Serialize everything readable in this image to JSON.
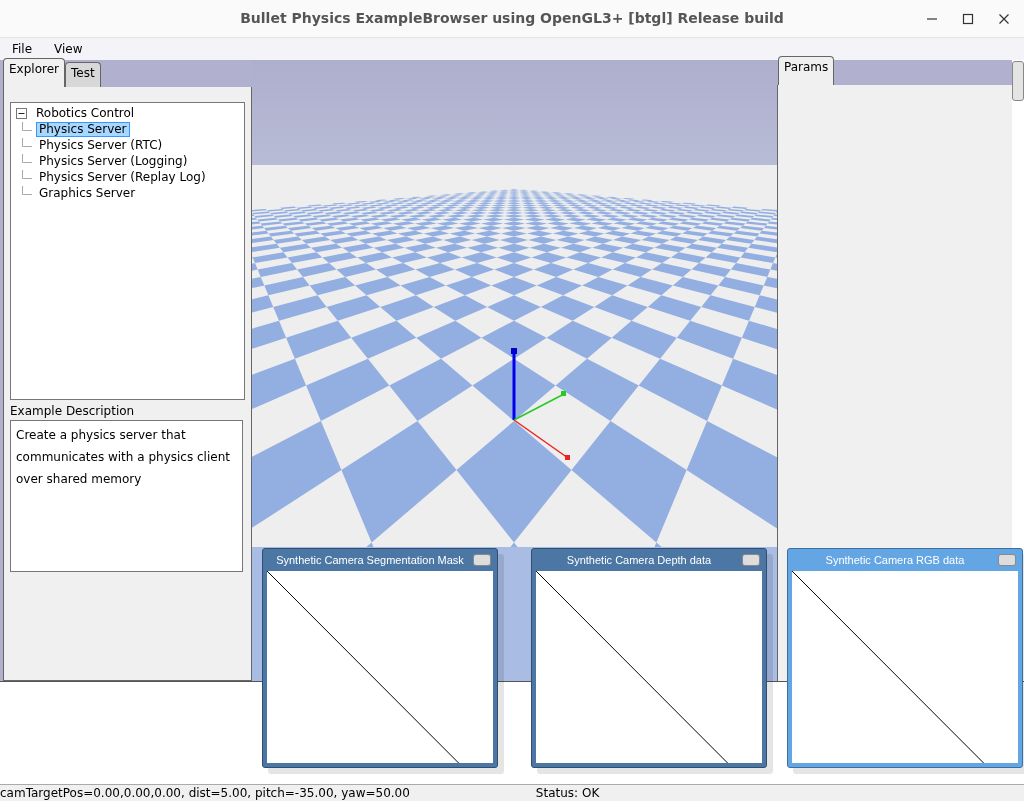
{
  "window": {
    "title": "Bullet Physics ExampleBrowser using OpenGL3+ [btgl] Release build"
  },
  "menu": [
    "File",
    "View"
  ],
  "left_tabs": [
    {
      "label": "Explorer",
      "selected": true
    },
    {
      "label": "Test",
      "selected": false
    }
  ],
  "tree": [
    {
      "label": "Robotics Control",
      "expanded": true,
      "selected": false,
      "children": [
        {
          "label": "Physics Server",
          "selected": true
        },
        {
          "label": "Physics Server (RTC)",
          "selected": false
        },
        {
          "label": "Physics Server (Logging)",
          "selected": false
        },
        {
          "label": "Physics Server (Replay Log)",
          "selected": false
        },
        {
          "label": "Graphics Server",
          "selected": false
        }
      ]
    }
  ],
  "description": {
    "heading": "Example Description",
    "lines": [
      "Create a physics server that",
      "communicates with a physics client",
      "over shared memory"
    ]
  },
  "right_tabs": [
    {
      "label": "Params",
      "selected": true
    }
  ],
  "camera_windows": [
    {
      "title": "Synthetic Camera Segmentation Mask",
      "active": false
    },
    {
      "title": "Synthetic Camera Depth data",
      "active": false
    },
    {
      "title": "Synthetic Camera RGB data",
      "active": true
    }
  ],
  "status_bar": {
    "camera": "camTargetPos=0.00,0.00,0.00, dist=5.00, pitch=-35.00, yaw=50.00",
    "status": "Status: OK"
  }
}
